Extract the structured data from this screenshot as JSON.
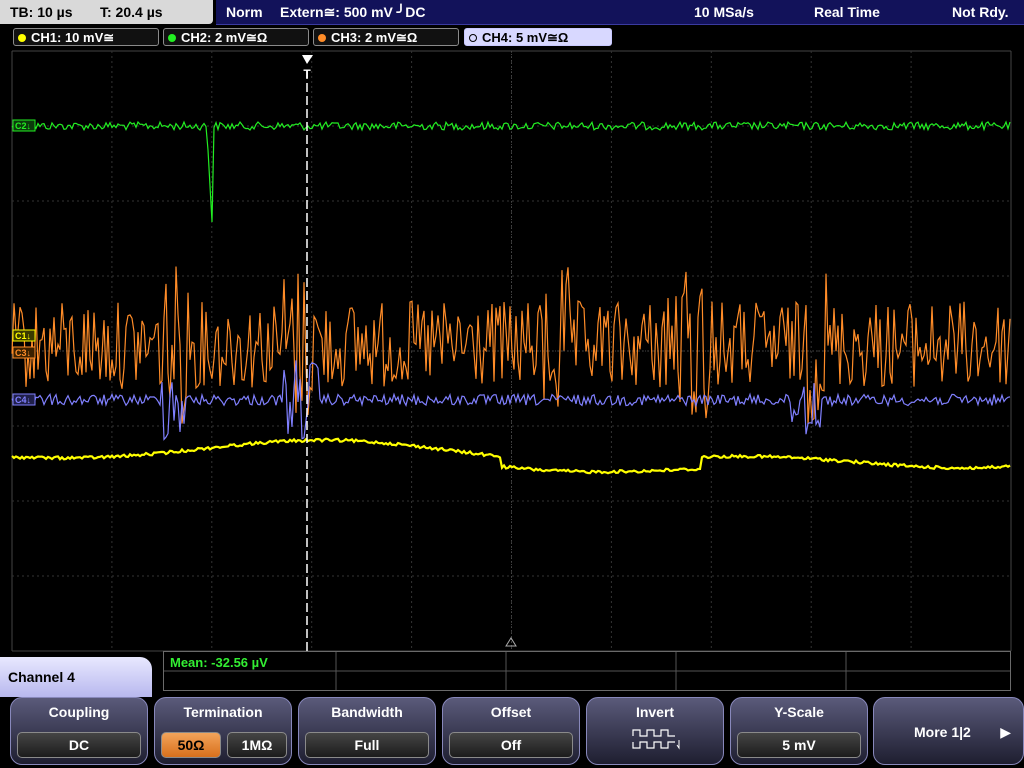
{
  "topbar": {
    "timebase": "TB: 10 µs",
    "trigger_time": "T: 20.4 µs",
    "mode": "Norm",
    "trigger_source": "Extern≅: 500 mV ╯DC",
    "sample_rate": "10 MSa/s",
    "acq_mode": "Real Time",
    "status": "Not Rdy."
  },
  "channels": [
    {
      "label": "CH1: 10 mV≅",
      "color": "#ffff00"
    },
    {
      "label": "CH2: 2 mV≅Ω",
      "color": "#22ee22"
    },
    {
      "label": "CH3: 2 mV≅Ω",
      "color": "#ff8c28"
    },
    {
      "label": "CH4: 5 mV≅Ω",
      "color": "#8080ff"
    }
  ],
  "trace_markers": {
    "c2": "C2↓",
    "c1": "C1↓",
    "c3": "C3↓",
    "c4": "C4↓"
  },
  "trigger_marker": "T",
  "measurement": {
    "mean": "Mean: -32.56 µV"
  },
  "menu": {
    "title": "Channel 4",
    "coupling": {
      "label": "Coupling",
      "value": "DC"
    },
    "termination": {
      "label": "Termination",
      "value_a": "50Ω",
      "value_b": "1MΩ"
    },
    "bandwidth": {
      "label": "Bandwidth",
      "value": "Full"
    },
    "offset": {
      "label": "Offset",
      "value": "Off"
    },
    "invert": {
      "label": "Invert"
    },
    "yscale": {
      "label": "Y-Scale",
      "value": "5 mV"
    },
    "more": {
      "label": "More 1|2"
    }
  }
}
